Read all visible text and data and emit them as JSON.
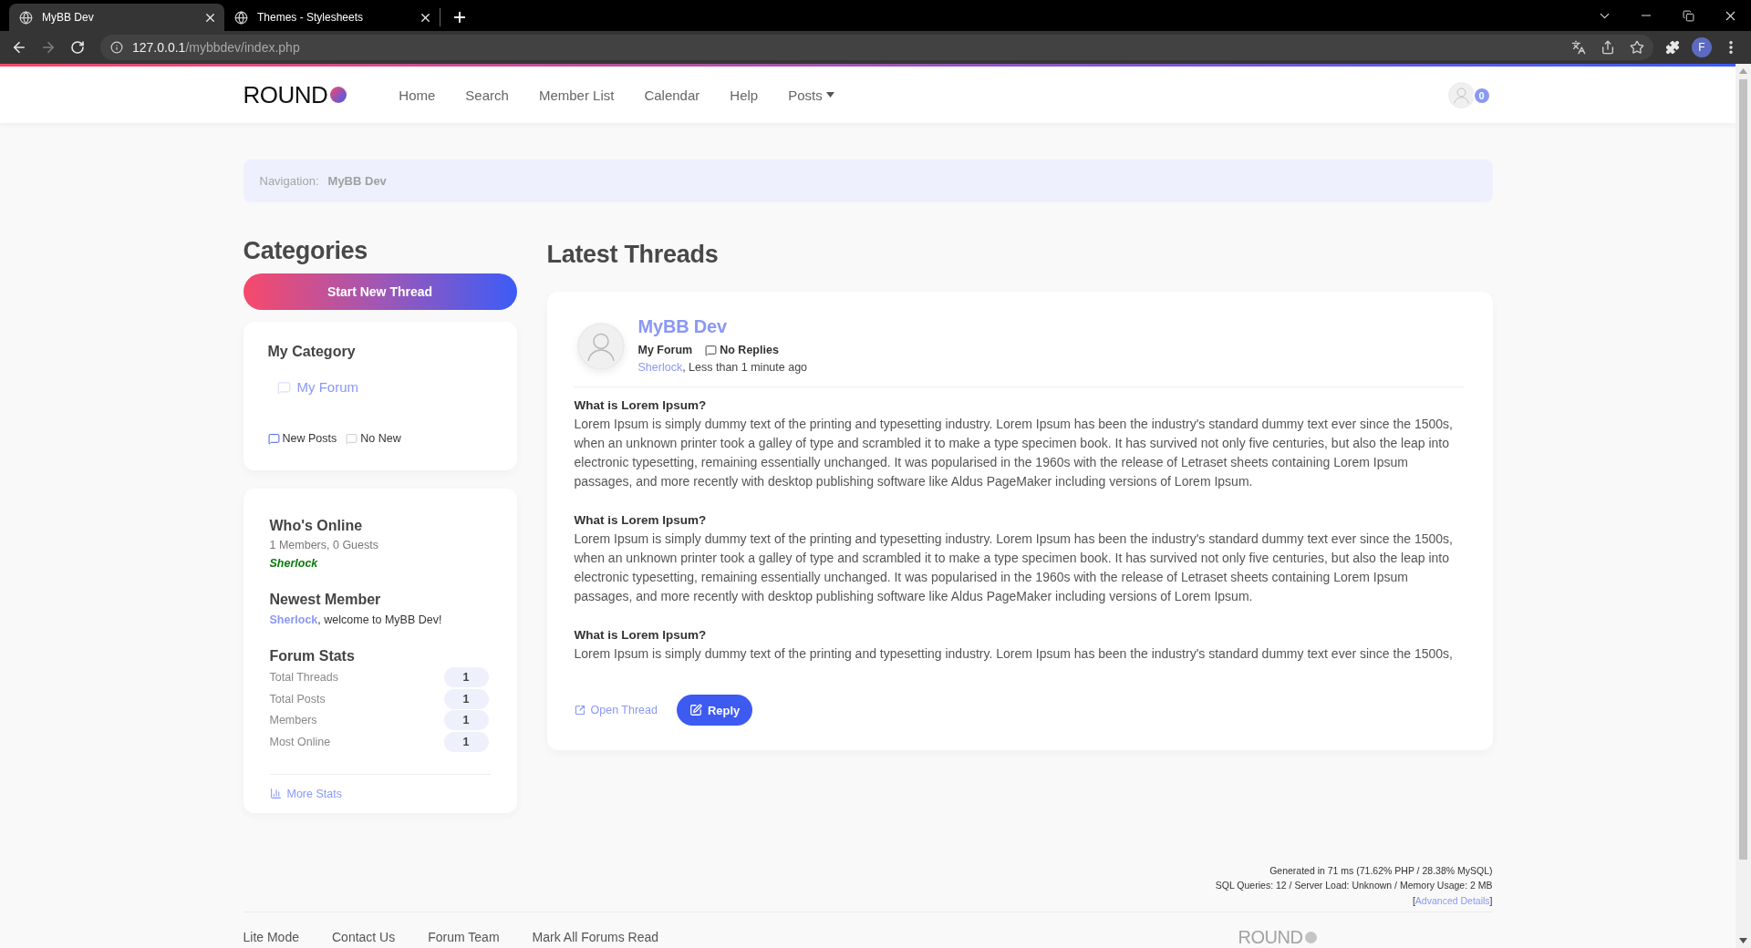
{
  "browser": {
    "tabs": [
      {
        "title": "MyBB Dev",
        "selected": true
      },
      {
        "title": "Themes - Stylesheets",
        "selected": false
      }
    ],
    "forward_disabled": true,
    "url_host": "127.0.0.1",
    "url_path": "/mybbdev/index.php",
    "profile": "F"
  },
  "header": {
    "logo": "ROUND",
    "nav": [
      {
        "label": "Home",
        "dropdown": false
      },
      {
        "label": "Search",
        "dropdown": false
      },
      {
        "label": "Member List",
        "dropdown": false
      },
      {
        "label": "Calendar",
        "dropdown": false
      },
      {
        "label": "Help",
        "dropdown": false
      },
      {
        "label": "Posts",
        "dropdown": true
      }
    ],
    "notification_count": "0"
  },
  "breadcrumb": {
    "label": "Navigation:",
    "items": [
      "MyBB Dev"
    ]
  },
  "sidebar": {
    "title": "Categories",
    "start_button": "Start New Thread",
    "category": {
      "name": "My Category",
      "forums": [
        {
          "name": "My Forum",
          "new_posts": false
        }
      ],
      "legend": [
        {
          "label": "New Posts",
          "kind": "new"
        },
        {
          "label": "No New",
          "kind": "none"
        }
      ]
    },
    "whos_online": {
      "title": "Who's Online",
      "summary": "1 Members, 0 Guests",
      "users": [
        "Sherlock"
      ]
    },
    "newest_member": {
      "title": "Newest Member",
      "user": "Sherlock",
      "message": ", welcome to MyBB Dev!"
    },
    "stats": {
      "title": "Forum Stats",
      "rows": [
        {
          "label": "Total Threads",
          "value": "1"
        },
        {
          "label": "Total Posts",
          "value": "1"
        },
        {
          "label": "Members",
          "value": "1"
        },
        {
          "label": "Most Online",
          "value": "1"
        }
      ]
    },
    "more_stats": "More Stats"
  },
  "main": {
    "title": "Latest Threads",
    "threads": [
      {
        "title": "MyBB Dev",
        "forum": "My Forum",
        "replies": "No Replies",
        "author": "Sherlock",
        "author_suffix": ", Less than 1 minute ago",
        "body": [
          {
            "heading": "What is Lorem Ipsum?",
            "text": "Lorem Ipsum is simply dummy text of the printing and typesetting industry. Lorem Ipsum has been the industry's standard dummy text ever since the 1500s, when an unknown printer took a galley of type and scrambled it to make a type specimen book. It has survived not only five centuries, but also the leap into electronic typesetting, remaining essentially unchanged. It was popularised in the 1960s with the release of Letraset sheets containing Lorem Ipsum passages, and more recently with desktop publishing software like Aldus PageMaker including versions of Lorem Ipsum."
          },
          {
            "heading": "What is Lorem Ipsum?",
            "text": "Lorem Ipsum is simply dummy text of the printing and typesetting industry. Lorem Ipsum has been the industry's standard dummy text ever since the 1500s, when an unknown printer took a galley of type and scrambled it to make a type specimen book. It has survived not only five centuries, but also the leap into electronic typesetting, remaining essentially unchanged. It was popularised in the 1960s with the release of Letraset sheets containing Lorem Ipsum passages, and more recently with desktop publishing software like Aldus PageMaker including versions of Lorem Ipsum."
          },
          {
            "heading": "What is Lorem Ipsum?",
            "text": "Lorem Ipsum is simply dummy text of the printing and typesetting industry. Lorem Ipsum has been the industry's standard dummy text ever since the 1500s,"
          }
        ],
        "open_label": "Open Thread",
        "reply_label": "Reply"
      }
    ]
  },
  "footer": {
    "debug_lines": [
      "Generated in 71 ms (71.62% PHP / 28.38% MySQL)",
      "SQL Queries: 12 / Server Load: Unknown / Memory Usage: 2 MB"
    ],
    "advanced": {
      "open": "[",
      "link": "Advanced Details",
      "close": "]"
    },
    "links": [
      "Lite Mode",
      "Contact Us",
      "Forum Team",
      "Mark All Forums Read"
    ],
    "logo": "ROUND"
  }
}
